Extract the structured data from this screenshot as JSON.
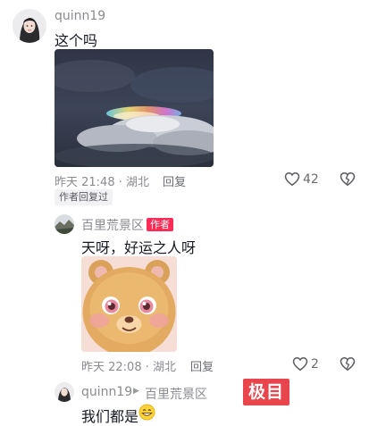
{
  "comment": {
    "username": "quinn19",
    "text": "这个吗",
    "meta": "昨天 21:48 · 湖北",
    "reply_label": "回复",
    "like_count": "42",
    "badge": "作者回复过"
  },
  "reply": {
    "username": "百里荒景区",
    "author_tag": "作者",
    "text": "天呀，好运之人呀",
    "meta": "昨天 22:08 · 湖北",
    "reply_label": "回复",
    "like_count": "2"
  },
  "nested_reply": {
    "username": "quinn19",
    "arrow": "▶",
    "target": "百里荒景区",
    "text": "我们都是"
  },
  "watermark": "极目",
  "colors": {
    "author_tag": "#fe2c55",
    "watermark": "#e8464c"
  }
}
